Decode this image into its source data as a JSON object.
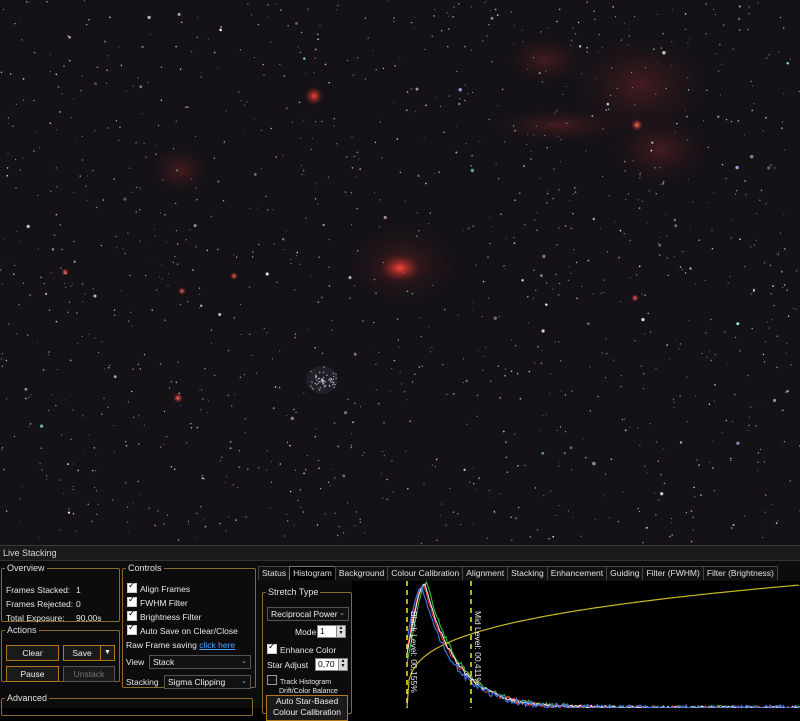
{
  "panel": {
    "title": "Live Stacking"
  },
  "overview": {
    "legend": "Overview",
    "frames_stacked_label": "Frames Stacked:",
    "frames_stacked_value": "1",
    "frames_rejected_label": "Frames Rejected:",
    "frames_rejected_value": "0",
    "total_exposure_label": "Total Exposure:",
    "total_exposure_value": "90,00s"
  },
  "actions": {
    "legend": "Actions",
    "clear_label": "Clear",
    "save_label": "Save",
    "save_menu_icon": "chevron-down-icon",
    "pause_label": "Pause",
    "unstack_label": "Unstack"
  },
  "advanced": {
    "legend": "Advanced"
  },
  "controls": {
    "legend": "Controls",
    "align_frames": {
      "label": "Align Frames",
      "checked": true
    },
    "fwhm_filter": {
      "label": "FWHM Filter",
      "checked": true
    },
    "brightness_filter": {
      "label": "Brightness Filter",
      "checked": true
    },
    "auto_save": {
      "label": "Auto Save on Clear/Close",
      "checked": true
    },
    "raw_frame_saving_label": "Raw Frame saving",
    "raw_frame_saving_link": "click here",
    "view_label": "View",
    "view_value": "Stack",
    "stacking_label": "Stacking",
    "stacking_value": "Sigma Clipping"
  },
  "tabs": [
    "Status",
    "Histogram",
    "Background",
    "Colour Calibration",
    "Alignment",
    "Stacking",
    "Enhancement",
    "Guiding",
    "Filter (FWHM)",
    "Filter (Brightness)"
  ],
  "active_tab": "Histogram",
  "stretch": {
    "legend": "Stretch Type",
    "type_value": "Reciprocal Power",
    "mode_label": "Mode",
    "mode_value": "1",
    "enhance_color": {
      "label": "Enhance Color",
      "checked": true
    },
    "star_adjust_label": "Star Adjust",
    "star_adjust_value": "0,70",
    "track_histogram": {
      "label_line1": "Track Histogram",
      "label_line2": "Drift/Color Balance",
      "checked": false
    },
    "auto_calibration_line1": "Auto Star-Based",
    "auto_calibration_line2": "Colour Calibration"
  },
  "histogram": {
    "black_level_label": "Black Level: 00,155%",
    "mid_level_label": "Mid Level: 00,411%",
    "colors": {
      "red": "#e23b2e",
      "green": "#3bbf3b",
      "blue": "#3d6fe6",
      "white": "#f4f4f4",
      "curve": "#c9b827",
      "marker": "#f2ea2c"
    }
  },
  "sky": {
    "background": "#141217",
    "nebula_color": "#d43a2a"
  }
}
